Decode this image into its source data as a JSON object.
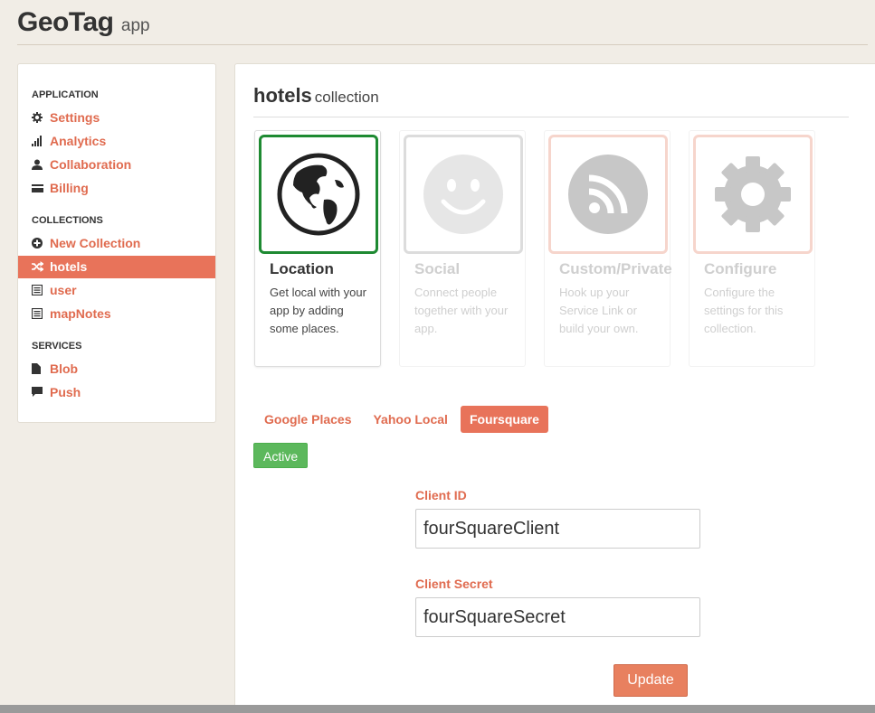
{
  "app": {
    "title": "GeoTag",
    "subtitle": "app"
  },
  "sidebar": {
    "sections": [
      {
        "label": "APPLICATION"
      },
      {
        "label": "COLLECTIONS"
      },
      {
        "label": "SERVICES"
      }
    ],
    "items": [
      {
        "label": "Settings",
        "icon": "gear-icon"
      },
      {
        "label": "Analytics",
        "icon": "bar-chart-icon"
      },
      {
        "label": "Collaboration",
        "icon": "user-icon"
      },
      {
        "label": "Billing",
        "icon": "credit-card-icon"
      },
      {
        "label": "New Collection",
        "icon": "plus-circle-icon"
      },
      {
        "label": "hotels",
        "icon": "shuffle-icon",
        "active": true
      },
      {
        "label": "user",
        "icon": "list-icon"
      },
      {
        "label": "mapNotes",
        "icon": "list-icon"
      },
      {
        "label": "Blob",
        "icon": "file-icon"
      },
      {
        "label": "Push",
        "icon": "comment-icon"
      }
    ]
  },
  "collection": {
    "name": "hotels",
    "suffix": "collection"
  },
  "cards": [
    {
      "title": "Location",
      "desc": "Get local with your app by adding some places.",
      "icon": "globe-icon",
      "active": true
    },
    {
      "title": "Social",
      "desc": "Connect people together with your app.",
      "icon": "smiley-icon",
      "active": false
    },
    {
      "title": "Custom/Private",
      "desc": "Hook up your Service Link or build your own.",
      "icon": "rss-icon",
      "active": false
    },
    {
      "title": "Configure",
      "desc": "Configure the settings for this collection.",
      "icon": "gear-icon",
      "active": false
    }
  ],
  "providers": [
    {
      "label": "Google Places",
      "active": false
    },
    {
      "label": "Yahoo Local",
      "active": false
    },
    {
      "label": "Foursquare",
      "active": true
    }
  ],
  "status": {
    "label": "Active",
    "color": "#5cb85c"
  },
  "form": {
    "client_id_label": "Client ID",
    "client_id_value": "fourSquareClient",
    "client_secret_label": "Client Secret",
    "client_secret_value": "fourSquareSecret",
    "submit_label": "Update"
  },
  "colors": {
    "accent": "#e8735a",
    "link": "#e06b4f",
    "active_border": "#1e8a32"
  }
}
